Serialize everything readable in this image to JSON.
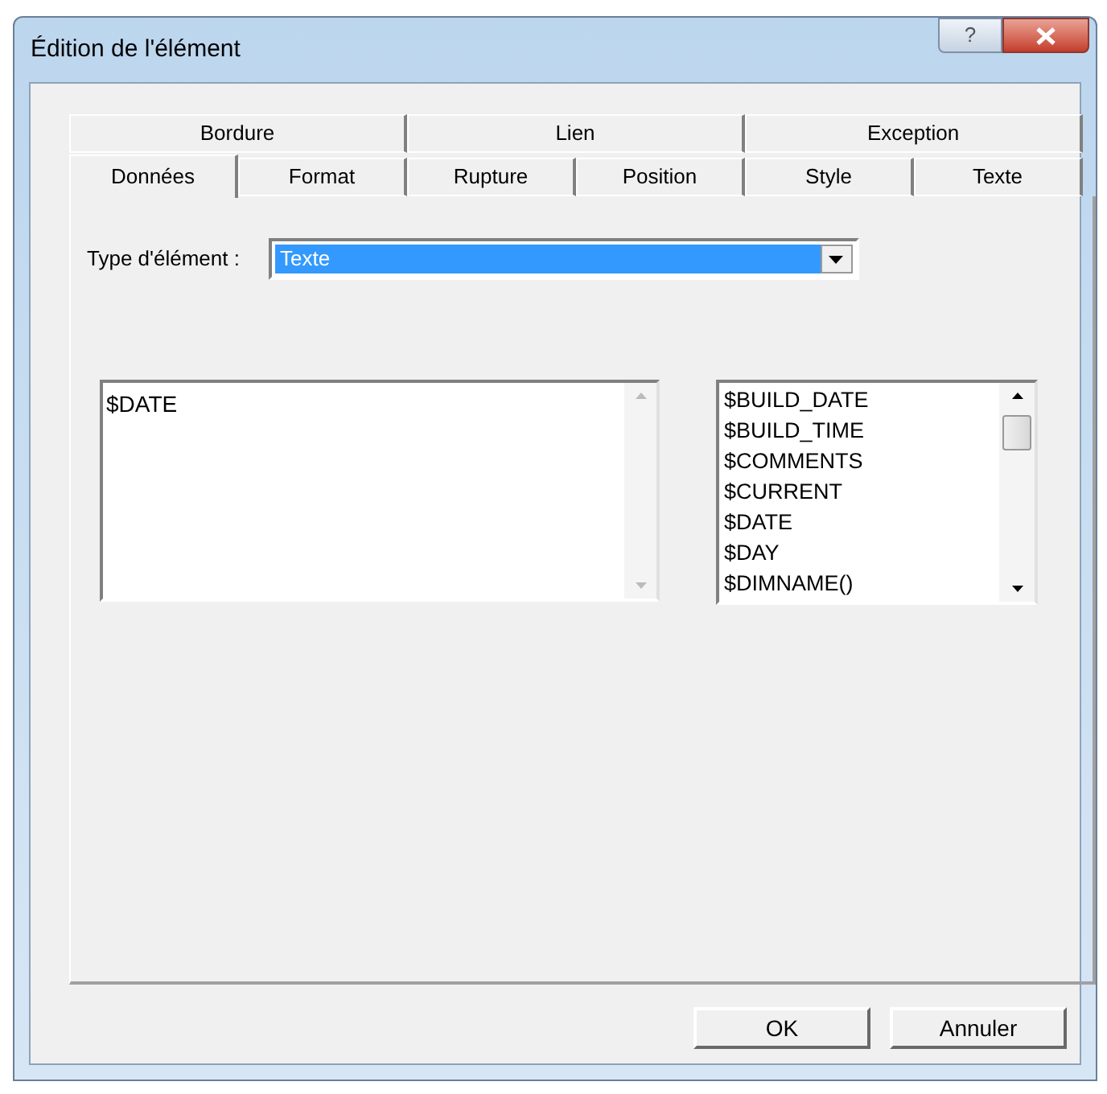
{
  "window": {
    "title": "Édition de l'élément",
    "help_button": "?"
  },
  "tab_rows": [
    [
      {
        "label": "Bordure",
        "selected": false
      },
      {
        "label": "Lien",
        "selected": false
      },
      {
        "label": "Exception",
        "selected": false
      }
    ],
    [
      {
        "label": "Données",
        "selected": true
      },
      {
        "label": "Format",
        "selected": false
      },
      {
        "label": "Rupture",
        "selected": false
      },
      {
        "label": "Position",
        "selected": false
      },
      {
        "label": "Style",
        "selected": false
      },
      {
        "label": "Texte",
        "selected": false
      }
    ]
  ],
  "element_type": {
    "label": "Type d'élément :",
    "value": "Texte",
    "selected": true
  },
  "expression": {
    "value": "$DATE"
  },
  "variables": [
    "$BUILD_DATE",
    "$BUILD_TIME",
    "$COMMENTS",
    "$CURRENT",
    "$DATE",
    "$DAY",
    "$DIMNAME()"
  ],
  "buttons": [
    "OK",
    "Annuler"
  ]
}
